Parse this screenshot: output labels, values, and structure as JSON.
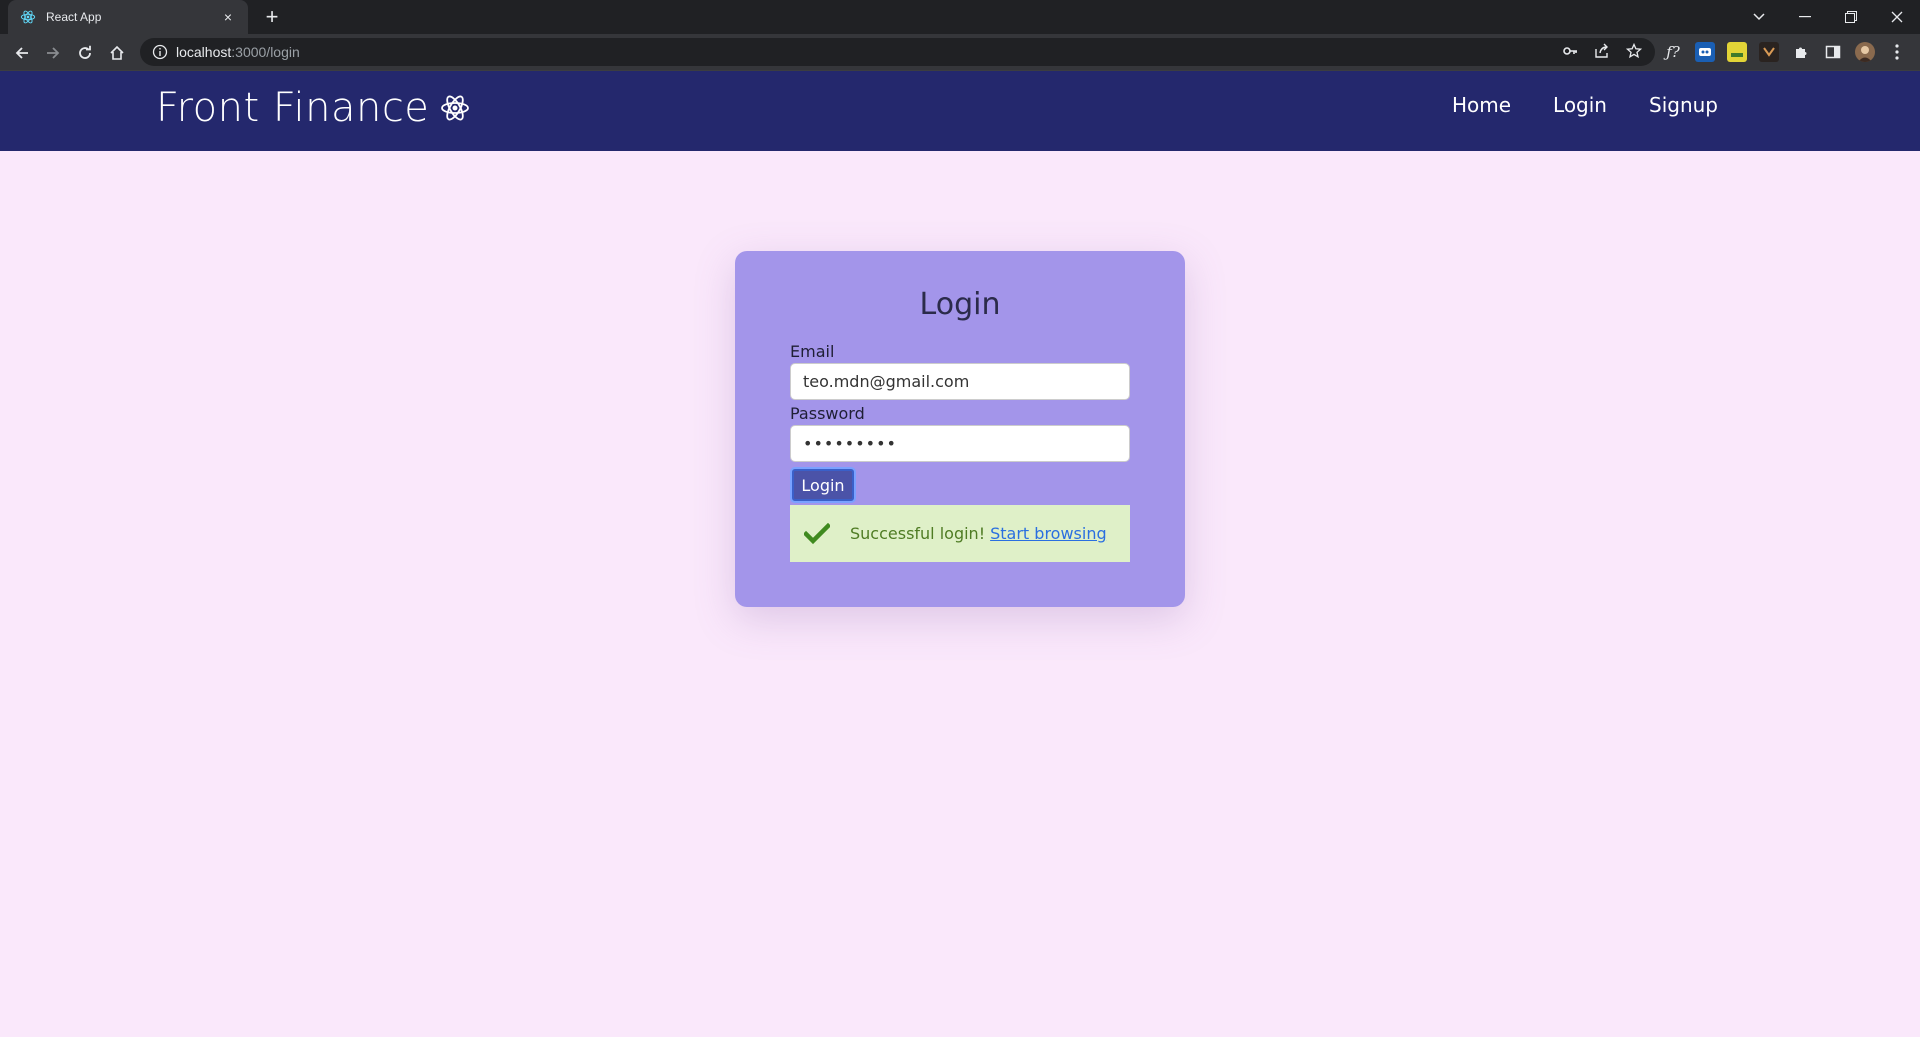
{
  "browser": {
    "tab_title": "React App",
    "tab_close": "×",
    "new_tab": "+",
    "url_host": "localhost",
    "url_path": ":3000/login",
    "window_controls": [
      "minimize-icon",
      "restore-icon",
      "close-icon"
    ],
    "toolbar_icons": [
      "back-arrow-icon",
      "forward-arrow-icon",
      "reload-icon",
      "home-icon",
      "info-icon"
    ],
    "omnibox_icons": [
      "key-icon",
      "share-icon",
      "star-icon"
    ],
    "extension_icons": [
      "function-ext-icon",
      "blue-ext-icon",
      "yellow-ext-icon",
      "dark-ext-icon",
      "puzzle-icon",
      "sidepanel-icon",
      "avatar",
      "kebab-menu-icon"
    ]
  },
  "header": {
    "brand": "Front Finance",
    "nav": [
      "Home",
      "Login",
      "Signup"
    ]
  },
  "login": {
    "title": "Login",
    "email_label": "Email",
    "email_value": "teo.mdn@gmail.com",
    "password_label": "Password",
    "password_value": "•••••••••",
    "button_label": "Login",
    "alert_text": "Successful login!",
    "alert_link": "Start browsing"
  },
  "colors": {
    "page_bg": "#fae8fb",
    "header_bg": "#24286d",
    "card_bg": "#a395ea",
    "button_bg": "#4b53a8",
    "alert_bg": "#dff0c8",
    "alert_text": "#4f7c24",
    "link": "#2a6fe0"
  }
}
